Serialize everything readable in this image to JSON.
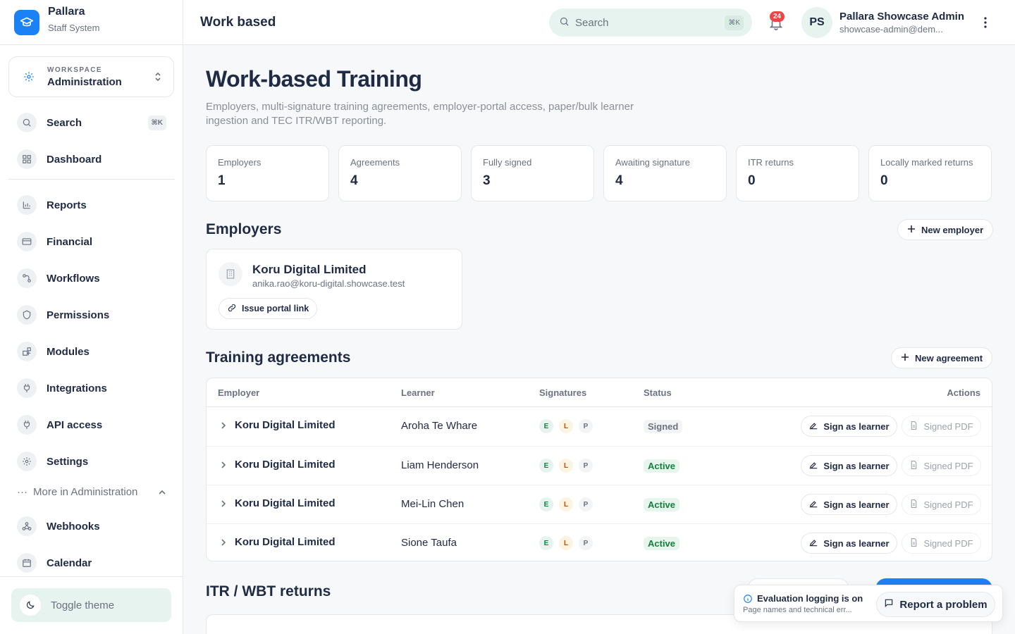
{
  "brand": {
    "name": "Pallara",
    "subtitle": "Staff System"
  },
  "workspace": {
    "label": "WORKSPACE",
    "name": "Administration"
  },
  "sidebar": {
    "search": {
      "label": "Search",
      "shortcut": "⌘K"
    },
    "items": [
      {
        "label": "Dashboard",
        "icon": "grid-icon"
      },
      {
        "label": "Reports",
        "icon": "bar-chart-icon"
      },
      {
        "label": "Financial",
        "icon": "credit-card-icon"
      },
      {
        "label": "Workflows",
        "icon": "workflow-icon"
      },
      {
        "label": "Permissions",
        "icon": "shield-icon"
      },
      {
        "label": "Modules",
        "icon": "modules-icon"
      },
      {
        "label": "Integrations",
        "icon": "plug-icon"
      },
      {
        "label": "API access",
        "icon": "plug-icon"
      },
      {
        "label": "Settings",
        "icon": "gear-icon"
      },
      {
        "label": "Webhooks",
        "icon": "webhook-icon"
      },
      {
        "label": "Calendar",
        "icon": "calendar-icon"
      }
    ],
    "more_label": "More in Administration",
    "toggle_theme": "Toggle theme"
  },
  "topbar": {
    "crumb": "Work based",
    "search_placeholder": "Search",
    "search_shortcut": "⌘K",
    "notifications_count": "24",
    "user_initials": "PS",
    "user_name": "Pallara Showcase Admin",
    "user_email": "showcase-admin@dem..."
  },
  "page": {
    "title": "Work-based Training",
    "description": "Employers, multi-signature training agreements, employer-portal access, paper/bulk learner ingestion and TEC ITR/WBT reporting."
  },
  "stats": [
    {
      "label": "Employers",
      "value": "1"
    },
    {
      "label": "Agreements",
      "value": "4"
    },
    {
      "label": "Fully signed",
      "value": "3"
    },
    {
      "label": "Awaiting signature",
      "value": "4"
    },
    {
      "label": "ITR returns",
      "value": "0"
    },
    {
      "label": "Locally marked returns",
      "value": "0"
    }
  ],
  "employers": {
    "title": "Employers",
    "new_button": "New employer",
    "card": {
      "name": "Koru Digital Limited",
      "email": "anika.rao@koru-digital.showcase.test",
      "portal_button": "Issue portal link"
    }
  },
  "agreements": {
    "title": "Training agreements",
    "new_button": "New agreement",
    "columns": [
      "Employer",
      "Learner",
      "Signatures",
      "Status",
      "Actions"
    ],
    "signature_letters": [
      "E",
      "L",
      "P"
    ],
    "sign_button": "Sign as learner",
    "pdf_button": "Signed PDF",
    "rows": [
      {
        "employer": "Koru Digital Limited",
        "learner": "Aroha Te Whare",
        "status": "Signed"
      },
      {
        "employer": "Koru Digital Limited",
        "learner": "Liam Henderson",
        "status": "Active"
      },
      {
        "employer": "Koru Digital Limited",
        "learner": "Mei-Lin Chen",
        "status": "Active"
      },
      {
        "employer": "Koru Digital Limited",
        "learner": "Sione Taufa",
        "status": "Active"
      }
    ]
  },
  "returns": {
    "title": "ITR / WBT returns"
  },
  "toast": {
    "title": "Evaluation logging is on",
    "subtitle": "Page names and technical err...",
    "report_button": "Report a problem"
  },
  "colors": {
    "accent": "#1b82f5",
    "mint": "#e6f3ee",
    "badge": "#ef4444"
  }
}
